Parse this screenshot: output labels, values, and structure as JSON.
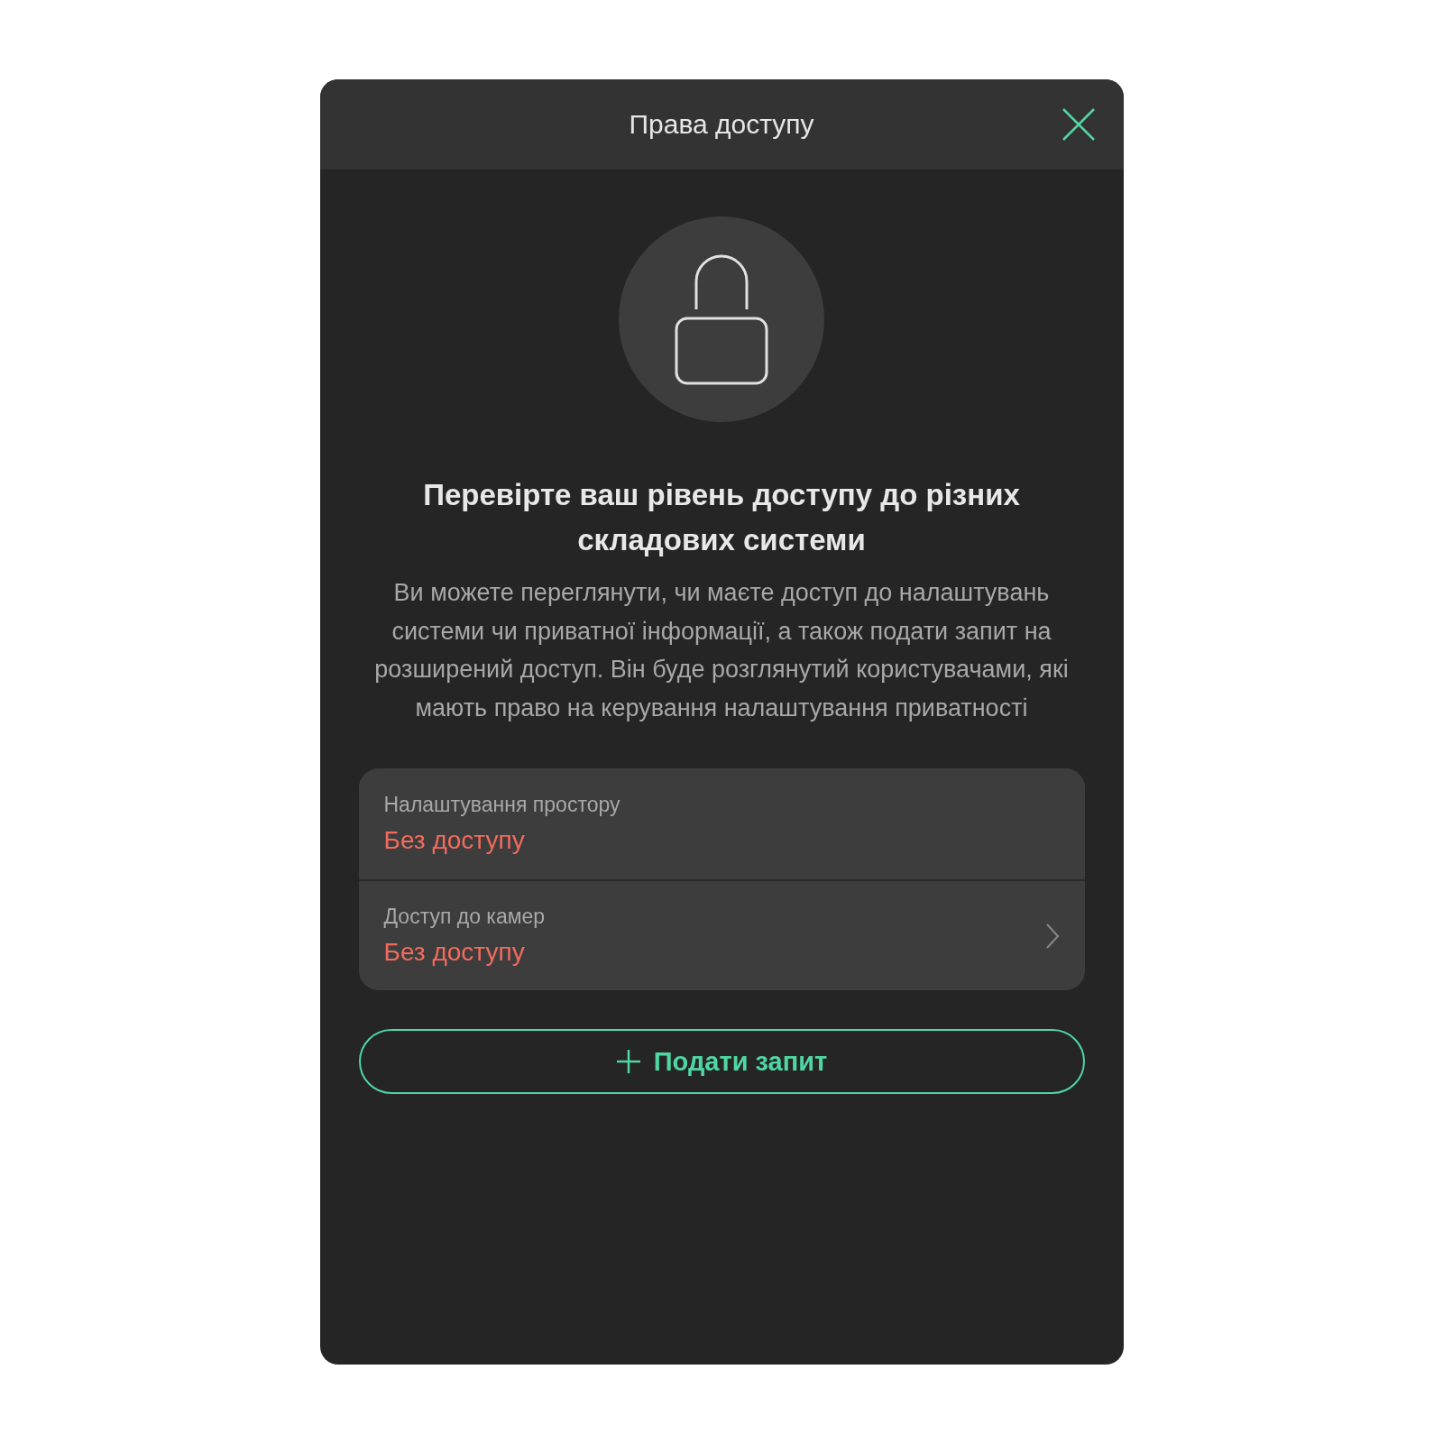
{
  "dialog": {
    "title": "Права доступу",
    "heading": "Перевірте ваш рівень доступу до різних складових системи",
    "description": "Ви можете переглянути, чи маєте доступ до налаштувань системи чи приватної інформації, а також подати запит на розширений доступ. Він буде розглянутий користувачами, які мають право на керування налаштування приватності"
  },
  "permissions": [
    {
      "label": "Налаштування простору",
      "status": "Без доступу",
      "navigable": false
    },
    {
      "label": "Доступ до камер",
      "status": "Без доступу",
      "navigable": true
    }
  ],
  "request_button": {
    "label": "Подати запит"
  }
}
